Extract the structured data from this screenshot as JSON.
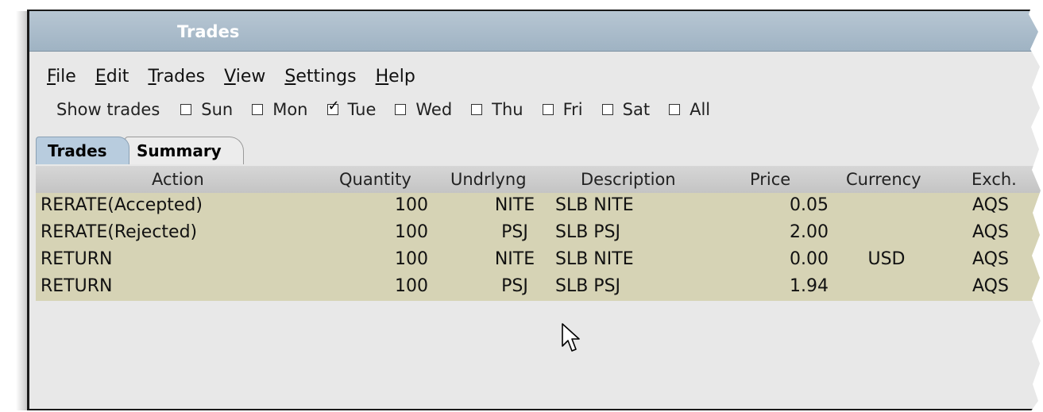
{
  "window": {
    "title": "Trades"
  },
  "menu": [
    {
      "mnemonic": "F",
      "rest": "ile"
    },
    {
      "mnemonic": "E",
      "rest": "dit"
    },
    {
      "mnemonic": "T",
      "rest": "rades"
    },
    {
      "mnemonic": "V",
      "rest": "iew"
    },
    {
      "mnemonic": "S",
      "rest": "ettings"
    },
    {
      "mnemonic": "H",
      "rest": "elp"
    }
  ],
  "filter": {
    "label": "Show trades",
    "days": [
      {
        "label": "Sun",
        "checked": false
      },
      {
        "label": "Mon",
        "checked": false
      },
      {
        "label": "Tue",
        "checked": true
      },
      {
        "label": "Wed",
        "checked": false
      },
      {
        "label": "Thu",
        "checked": false
      },
      {
        "label": "Fri",
        "checked": false
      },
      {
        "label": "Sat",
        "checked": false
      },
      {
        "label": "All",
        "checked": false
      }
    ]
  },
  "tabs": [
    {
      "label": "Trades",
      "active": true
    },
    {
      "label": "Summary",
      "active": false
    }
  ],
  "table": {
    "headers": {
      "action": "Action",
      "quantity": "Quantity",
      "underlying": "Undrlyng",
      "description": "Description",
      "price": "Price",
      "currency": "Currency",
      "exchange": "Exch."
    },
    "rows": [
      {
        "action": "RERATE(Accepted)",
        "quantity": "100",
        "underlying": "NITE",
        "description": "SLB NITE",
        "price": "0.05",
        "currency": "",
        "exchange": "AQS"
      },
      {
        "action": "RERATE(Rejected)",
        "quantity": "100",
        "underlying": "PSJ",
        "description": "SLB PSJ",
        "price": "2.00",
        "currency": "",
        "exchange": "AQS"
      },
      {
        "action": "RETURN",
        "quantity": "100",
        "underlying": "NITE",
        "description": "SLB NITE",
        "price": "0.00",
        "currency": "USD",
        "exchange": "AQS"
      },
      {
        "action": "RETURN",
        "quantity": "100",
        "underlying": "PSJ",
        "description": "SLB PSJ",
        "price": "1.94",
        "currency": "",
        "exchange": "AQS"
      }
    ]
  },
  "colors": {
    "titlebar": "#a9bccb",
    "row_bg": "#d6d3b5",
    "active_tab": "#b8ccde"
  }
}
